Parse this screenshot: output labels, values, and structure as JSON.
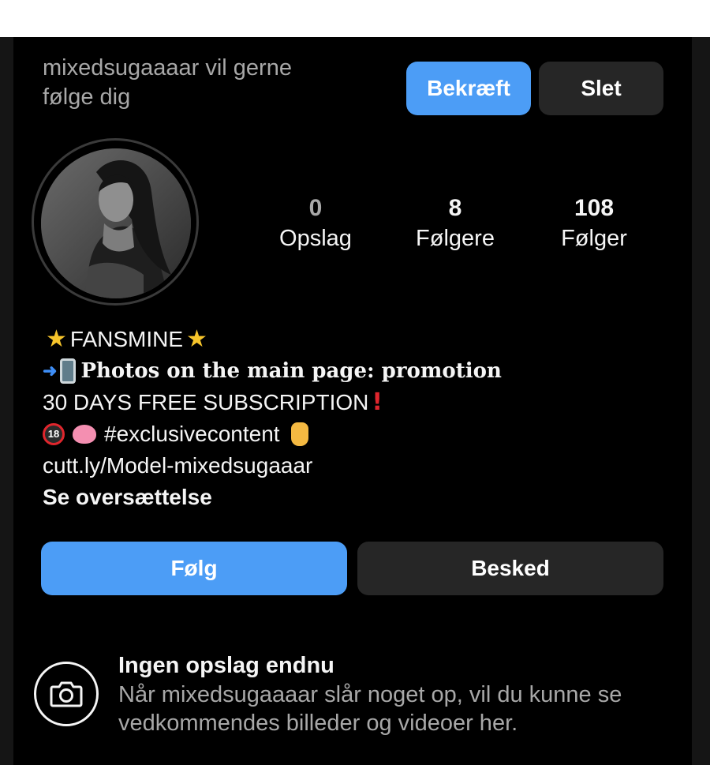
{
  "follow_request": {
    "text_line1": "mixedsugaaaar vil gerne",
    "text_line2": "følge dig",
    "confirm_label": "Bekræft",
    "delete_label": "Slet"
  },
  "profile": {
    "stats": [
      {
        "value": "0",
        "label": "Opslag"
      },
      {
        "value": "8",
        "label": "Følgere"
      },
      {
        "value": "108",
        "label": "Følger"
      }
    ],
    "bio": {
      "line1": "FANSMINE",
      "line2": "Photos on the main page: promotion",
      "line3": "30 DAYS FREE SUBSCRIPTION",
      "line4": "#exclusivecontent",
      "badge18": "18",
      "line5": "cutt.ly/Model-mixedsugaaar",
      "translate_label": "Se oversættelse"
    }
  },
  "actions": {
    "follow_label": "Følg",
    "message_label": "Besked"
  },
  "empty_state": {
    "title": "Ingen opslag endnu",
    "description_line1": "Når mixedsugaaaar slår noget op, vil du kunne se",
    "description_line2": "vedkommendes billeder og videoer her."
  },
  "colors": {
    "accent": "#4c9df6",
    "secondary_button": "#262626",
    "background": "#000000",
    "muted_text": "#a8a8a8"
  }
}
